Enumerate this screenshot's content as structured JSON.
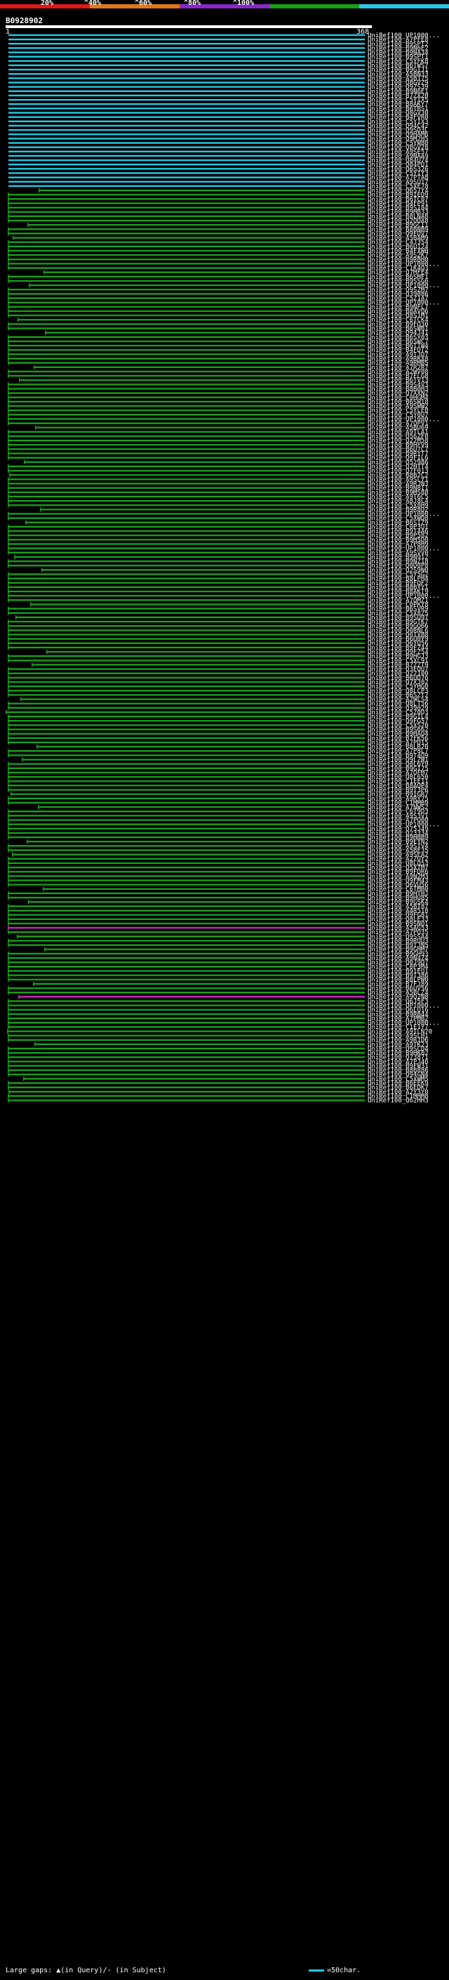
{
  "scale": {
    "ticks": [
      "20%",
      "^40%",
      "^60%",
      "^80%",
      "^100%"
    ],
    "colors": [
      "#e01818",
      "#e07818",
      "#8828c8",
      "#18a018",
      "#28c8e8"
    ]
  },
  "query": {
    "id": "B0928902",
    "start": "1",
    "end": "368"
  },
  "palette": {
    "cyan": "#28c8e8",
    "green": "#18a018",
    "magenta": "#c828b8",
    "gap": "#ffffff"
  },
  "hits": [
    {
      "label": "UniRef100_UP1000...",
      "color": "cyan"
    },
    {
      "label": "UniRef100_A7PFE8",
      "color": "cyan"
    },
    {
      "label": "UniRef100_B9SPT2",
      "color": "cyan"
    },
    {
      "label": "UniRef100_B9N6E2",
      "color": "cyan"
    },
    {
      "label": "UniRef100_B9NA34",
      "color": "cyan"
    },
    {
      "label": "UniRef100_B9SPT1",
      "color": "cyan"
    },
    {
      "label": "UniRef100_C5YFK8",
      "color": "cyan"
    },
    {
      "label": "UniRef100_B6TWS7",
      "color": "cyan"
    },
    {
      "label": "UniRef100_B9GIJ1",
      "color": "cyan"
    },
    {
      "label": "UniRef100_A5BN33",
      "color": "cyan"
    },
    {
      "label": "UniRef100_A5B175",
      "color": "cyan"
    },
    {
      "label": "UniRef100_Q8GVZ9",
      "color": "cyan"
    },
    {
      "label": "UniRef100_Q9ZS39",
      "color": "cyan"
    },
    {
      "label": "UniRef100_B9N6E1",
      "color": "cyan"
    },
    {
      "label": "UniRef100_B7ZX20",
      "color": "cyan"
    },
    {
      "label": "UniRef100_C5YIX5",
      "color": "cyan"
    },
    {
      "label": "UniRef100_B8AKY7",
      "color": "cyan"
    },
    {
      "label": "UniRef100_B6TBS1",
      "color": "cyan"
    },
    {
      "label": "UniRef100_Q8GV30",
      "color": "cyan"
    },
    {
      "label": "UniRef100_B4FVR0",
      "color": "cyan"
    },
    {
      "label": "UniRef100_C5YIX3",
      "color": "cyan"
    },
    {
      "label": "UniRef100_Q94C42",
      "color": "cyan"
    },
    {
      "label": "UniRef100_Q9SD3L",
      "color": "cyan"
    },
    {
      "label": "UniRef100_Q9HAM6",
      "color": "cyan"
    },
    {
      "label": "UniRef100_Q9M2H5",
      "color": "cyan"
    },
    {
      "label": "UniRef100_C5YW80",
      "color": "cyan"
    },
    {
      "label": "UniRef100_Q8GV28",
      "color": "cyan"
    },
    {
      "label": "UniRef100_A9SE57",
      "color": "cyan"
    },
    {
      "label": "UniRef100_A9NAA9",
      "color": "cyan"
    },
    {
      "label": "UniRef100_Q84U74",
      "color": "cyan"
    },
    {
      "label": "UniRef100_Q84PD1",
      "color": "cyan"
    },
    {
      "label": "UniRef100_Q6S326",
      "color": "cyan"
    },
    {
      "label": "UniRef100_C5YIY3",
      "color": "cyan"
    },
    {
      "label": "UniRef100_A7PTA8",
      "color": "cyan"
    },
    {
      "label": "UniRef100_A9SU17",
      "color": "cyan"
    },
    {
      "label": "UniRef100_C5XE78",
      "color": "cyan"
    },
    {
      "label": "UniRef100_Q657Y4",
      "color": "green"
    },
    {
      "label": "UniRef100_B9IED9",
      "color": "green"
    },
    {
      "label": "UniRef100_B6TC07",
      "color": "green"
    },
    {
      "label": "UniRef100_B4FP91",
      "color": "green"
    },
    {
      "label": "UniRef100_B9SI84",
      "color": "green"
    },
    {
      "label": "UniRef100_B9HB33",
      "color": "green"
    },
    {
      "label": "UniRef100_B8LNA8",
      "color": "green"
    },
    {
      "label": "UniRef100_Q2QDA8",
      "color": "green"
    },
    {
      "label": "UniRef100_B9GCI1",
      "color": "green"
    },
    {
      "label": "UniRef100_B8BNB9",
      "color": "green"
    },
    {
      "label": "UniRef100_Q9FDV7",
      "color": "green"
    },
    {
      "label": "UniRef100_A5BAM9",
      "color": "green"
    },
    {
      "label": "UniRef100_C4J354",
      "color": "green"
    },
    {
      "label": "UniRef100_B6U124",
      "color": "green"
    },
    {
      "label": "UniRef100_B4FXW0",
      "color": "green"
    },
    {
      "label": "UniRef100_A9S2K7",
      "color": "green"
    },
    {
      "label": "UniRef100_B9RBH0",
      "color": "green"
    },
    {
      "label": "UniRef100_UP1000...",
      "color": "green"
    },
    {
      "label": "UniRef100_C1K4Q3",
      "color": "green"
    },
    {
      "label": "UniRef100_Q7MFE4",
      "color": "green"
    },
    {
      "label": "UniRef100_B6SMF1",
      "color": "green"
    },
    {
      "label": "UniRef100_B9SSG6",
      "color": "green"
    },
    {
      "label": "UniRef100_UP1000...",
      "color": "green"
    },
    {
      "label": "UniRef100_Q9SZM7",
      "color": "green"
    },
    {
      "label": "UniRef100_Q39086",
      "color": "green"
    },
    {
      "label": "UniRef100_C5Z1A7",
      "color": "green"
    },
    {
      "label": "UniRef100_UP1000...",
      "color": "green"
    },
    {
      "label": "UniRef100_B9NFL7",
      "color": "green"
    },
    {
      "label": "UniRef100_B8AVQ6",
      "color": "green"
    },
    {
      "label": "UniRef100_Q8S1M1",
      "color": "green"
    },
    {
      "label": "UniRef100_C6TCK4",
      "color": "green"
    },
    {
      "label": "UniRef100_B9FQ30",
      "color": "green"
    },
    {
      "label": "UniRef100_B6SWB1",
      "color": "green"
    },
    {
      "label": "UniRef100_Q94J41",
      "color": "green"
    },
    {
      "label": "UniRef100_B6SY03",
      "color": "green"
    },
    {
      "label": "UniRef100_B6SWC7",
      "color": "green"
    },
    {
      "label": "UniRef100_B6TTW4",
      "color": "green"
    },
    {
      "label": "UniRef100_B4FDT2",
      "color": "green"
    },
    {
      "label": "UniRef100_A9TJD7",
      "color": "green"
    },
    {
      "label": "UniRef100_A9RKX8",
      "color": "green"
    },
    {
      "label": "UniRef100_A9RMB5",
      "color": "green"
    },
    {
      "label": "UniRef100_A7R2R7",
      "color": "green"
    },
    {
      "label": "UniRef100_A2WV08",
      "color": "green"
    },
    {
      "label": "UniRef100_B7FLG8",
      "color": "green"
    },
    {
      "label": "UniRef100_B6TV13",
      "color": "green"
    },
    {
      "label": "UniRef100_B9S4V3",
      "color": "green"
    },
    {
      "label": "UniRef100_B8B0H3",
      "color": "green"
    },
    {
      "label": "UniRef100_Q7XXN2",
      "color": "green"
    },
    {
      "label": "UniRef100_C0HGM4",
      "color": "green"
    },
    {
      "label": "UniRef100_B6SW18",
      "color": "green"
    },
    {
      "label": "UniRef100_A9SWW2",
      "color": "green"
    },
    {
      "label": "UniRef100_C5YLE0",
      "color": "green"
    },
    {
      "label": "UniRef100_C5Y0U7",
      "color": "green"
    },
    {
      "label": "UniRef100_UP1000...",
      "color": "green"
    },
    {
      "label": "UniRef100_A7QPV1",
      "color": "green"
    },
    {
      "label": "UniRef100_A5BU69",
      "color": "green"
    },
    {
      "label": "UniRef100_A9TLA1",
      "color": "green"
    },
    {
      "label": "UniRef100_Q56ZF0",
      "color": "green"
    },
    {
      "label": "UniRef100_Q22M58",
      "color": "green"
    },
    {
      "label": "UniRef100_B9HFV9",
      "color": "green"
    },
    {
      "label": "UniRef100_B6U7C7",
      "color": "green"
    },
    {
      "label": "UniRef100_B9RYT7",
      "color": "green"
    },
    {
      "label": "UniRef100_Q9FIL6",
      "color": "green"
    },
    {
      "label": "UniRef100_Q52986",
      "color": "green"
    },
    {
      "label": "UniRef100_Q2HTT4",
      "color": "green"
    },
    {
      "label": "UniRef100_Q7F013",
      "color": "green"
    },
    {
      "label": "UniRef100_B8B2C2",
      "color": "green"
    },
    {
      "label": "UniRef100_A9SLY1",
      "color": "green"
    },
    {
      "label": "UniRef100_A9RJN3",
      "color": "green"
    },
    {
      "label": "UniRef100_B9N8I1",
      "color": "green"
    },
    {
      "label": "UniRef100_B9MS88",
      "color": "green"
    },
    {
      "label": "UniRef100_A9T6C5",
      "color": "green"
    },
    {
      "label": "UniRef100_A8J8L4",
      "color": "green"
    },
    {
      "label": "UniRef100_C5X8H9",
      "color": "green"
    },
    {
      "label": "UniRef100_B9R8D2",
      "color": "green"
    },
    {
      "label": "UniRef100_UP1000...",
      "color": "green"
    },
    {
      "label": "UniRef100_C5XWD8",
      "color": "green"
    },
    {
      "label": "UniRef100_B6SIZ9",
      "color": "green"
    },
    {
      "label": "UniRef100_C0P3U1",
      "color": "green"
    },
    {
      "label": "UniRef100_B9T4A6",
      "color": "green"
    },
    {
      "label": "UniRef100_B9P582",
      "color": "green"
    },
    {
      "label": "UniRef100_B9M5D0",
      "color": "green"
    },
    {
      "label": "UniRef100_A7P8H9",
      "color": "green"
    },
    {
      "label": "UniRef100_UP1000...",
      "color": "green"
    },
    {
      "label": "UniRef100_A9SVV0",
      "color": "green"
    },
    {
      "label": "UniRef100_B9N912",
      "color": "green"
    },
    {
      "label": "UniRef100_B9NZ18",
      "color": "green"
    },
    {
      "label": "UniRef100_Q0D0P8",
      "color": "green"
    },
    {
      "label": "UniRef100_Q2S9N0",
      "color": "green"
    },
    {
      "label": "UniRef100_C5Y5G2",
      "color": "green"
    },
    {
      "label": "UniRef100_B8LPH4",
      "color": "green"
    },
    {
      "label": "UniRef100_B9FQF2",
      "color": "green"
    },
    {
      "label": "UniRef100_B8BYY1",
      "color": "green"
    },
    {
      "label": "UniRef100_B8AKT9",
      "color": "green"
    },
    {
      "label": "UniRef100_UP1000...",
      "color": "green"
    },
    {
      "label": "UniRef100_A7QMZ1",
      "color": "green"
    },
    {
      "label": "UniRef100_C0PKY8",
      "color": "green"
    },
    {
      "label": "UniRef100_B6SVR9",
      "color": "green"
    },
    {
      "label": "UniRef100_C5X8Z5",
      "color": "green"
    },
    {
      "label": "UniRef100_B9SU97",
      "color": "green"
    },
    {
      "label": "UniRef100_B9GTK7",
      "color": "green"
    },
    {
      "label": "UniRef100_B9GQ66",
      "color": "green"
    },
    {
      "label": "UniRef100_Q0RNL6",
      "color": "green"
    },
    {
      "label": "UniRef100_Q0IXB8",
      "color": "green"
    },
    {
      "label": "UniRef100_B6U0Y9",
      "color": "green"
    },
    {
      "label": "UniRef100_Q6YU56",
      "color": "green"
    },
    {
      "label": "UniRef100_B9FZ44",
      "color": "green"
    },
    {
      "label": "UniRef100_Q9FZ54",
      "color": "green"
    },
    {
      "label": "UniRef100_B9HGJ3",
      "color": "green"
    },
    {
      "label": "UniRef100_C5XL91",
      "color": "green"
    },
    {
      "label": "UniRef100_B7ZZT9",
      "color": "green"
    },
    {
      "label": "UniRef100_Q3EQU7",
      "color": "green"
    },
    {
      "label": "UniRef100_Q22100",
      "color": "green"
    },
    {
      "label": "UniRef100_B6UD76",
      "color": "green"
    },
    {
      "label": "UniRef100_Q7XJ02",
      "color": "green"
    },
    {
      "label": "UniRef100_C5YHG0",
      "color": "green"
    },
    {
      "label": "UniRef100_Q8LCP3",
      "color": "green"
    },
    {
      "label": "UniRef100_B6SZT2",
      "color": "green"
    },
    {
      "label": "UniRef100_A2WLS4",
      "color": "green"
    },
    {
      "label": "UniRef100_Q8LT56",
      "color": "green"
    },
    {
      "label": "UniRef100_Q39029",
      "color": "green"
    },
    {
      "label": "UniRef100_C5Z0D3",
      "color": "green"
    },
    {
      "label": "UniRef100_B9GIL4",
      "color": "green"
    },
    {
      "label": "UniRef100_Q9FG57",
      "color": "green"
    },
    {
      "label": "UniRef100_C5XS20",
      "color": "green"
    },
    {
      "label": "UniRef100_B9S662",
      "color": "green"
    },
    {
      "label": "UniRef100_B9HAU4",
      "color": "green"
    },
    {
      "label": "UniRef100_B7FK56",
      "color": "green"
    },
    {
      "label": "UniRef100_A7PD15",
      "color": "green"
    },
    {
      "label": "UniRef100_B8LR20",
      "color": "green"
    },
    {
      "label": "UniRef100_A7P8L7",
      "color": "green"
    },
    {
      "label": "UniRef100_B9T4Q9",
      "color": "green"
    },
    {
      "label": "UniRef100_Q9LZW1",
      "color": "green"
    },
    {
      "label": "UniRef100_Q8L6Y9",
      "color": "green"
    },
    {
      "label": "UniRef100_B9GI75",
      "color": "green"
    },
    {
      "label": "UniRef100_A7QFM7",
      "color": "green"
    },
    {
      "label": "UniRef100_Q8L650",
      "color": "green"
    },
    {
      "label": "UniRef100_C1EE11",
      "color": "green"
    },
    {
      "label": "UniRef100_B8AQP4",
      "color": "green"
    },
    {
      "label": "UniRef100_B9T3P6",
      "color": "green"
    },
    {
      "label": "UniRef100_B9IGR7",
      "color": "green"
    },
    {
      "label": "UniRef100_A9RY75",
      "color": "green"
    },
    {
      "label": "UniRef100_C1MMB9",
      "color": "green"
    },
    {
      "label": "UniRef100_A7NWS2",
      "color": "green"
    },
    {
      "label": "UniRef100_C6T9D3",
      "color": "green"
    },
    {
      "label": "UniRef100_A9S3V1",
      "color": "green"
    },
    {
      "label": "UniRef100_A7PU00",
      "color": "green"
    },
    {
      "label": "UniRef100_UP1000...",
      "color": "green"
    },
    {
      "label": "UniRef100_Q75J49",
      "color": "green"
    },
    {
      "label": "UniRef100_Q23334",
      "color": "green"
    },
    {
      "label": "UniRef100_B9HBB9",
      "color": "green"
    },
    {
      "label": "UniRef100_B9EYN2",
      "color": "green"
    },
    {
      "label": "UniRef100_A9SIV4",
      "color": "green"
    },
    {
      "label": "UniRef100_A5BE35",
      "color": "green"
    },
    {
      "label": "UniRef100_A9SEA2",
      "color": "green"
    },
    {
      "label": "UniRef100_A2ZUY2",
      "color": "green"
    },
    {
      "label": "UniRef100_Q8LQ53",
      "color": "green"
    },
    {
      "label": "UniRef100_Q5XTM7",
      "color": "green"
    },
    {
      "label": "UniRef100_B9FDR6",
      "color": "green"
    },
    {
      "label": "UniRef100_A9N2M3",
      "color": "green"
    },
    {
      "label": "UniRef100_Q9FM43",
      "color": "green"
    },
    {
      "label": "UniRef100_Q6VU56",
      "color": "green"
    },
    {
      "label": "UniRef100_C6TMB0",
      "color": "green"
    },
    {
      "label": "UniRef100_B9HTHJ",
      "color": "green"
    },
    {
      "label": "UniRef100_B9HU85",
      "color": "green"
    },
    {
      "label": "UniRef100_B9GSK4",
      "color": "green"
    },
    {
      "label": "UniRef100_A5BI87",
      "color": "green"
    },
    {
      "label": "UniRef100_A4R518",
      "color": "green"
    },
    {
      "label": "UniRef100_Q9FG81",
      "color": "green"
    },
    {
      "label": "UniRef100_Q8LE33",
      "color": "green"
    },
    {
      "label": "UniRef100_B9SNQ1",
      "color": "green"
    },
    {
      "label": "UniRef100_A5AG53",
      "color": "magenta"
    },
    {
      "label": "UniRef100_A7PQ35",
      "color": "green"
    },
    {
      "label": "UniRef100_Q9SSA4",
      "color": "green"
    },
    {
      "label": "UniRef100_B9RUU3",
      "color": "green"
    },
    {
      "label": "UniRef100_B9IJN5",
      "color": "green"
    },
    {
      "label": "UniRef100_B9GHM7",
      "color": "green"
    },
    {
      "label": "UniRef100_B9GH93",
      "color": "green"
    },
    {
      "label": "UniRef100_A9N4Z4",
      "color": "green"
    },
    {
      "label": "UniRef100_Q0J9D7",
      "color": "green"
    },
    {
      "label": "UniRef100_C0P3M4",
      "color": "green"
    },
    {
      "label": "UniRef100_B9IEQ1",
      "color": "green"
    },
    {
      "label": "UniRef100_B9I386",
      "color": "green"
    },
    {
      "label": "UniRef100_B8LPW0",
      "color": "green"
    },
    {
      "label": "UniRef100_B7FJ89",
      "color": "green"
    },
    {
      "label": "UniRef100_B6UV56",
      "color": "green"
    },
    {
      "label": "UniRef100_A5BLZ4",
      "color": "green"
    },
    {
      "label": "UniRef100_A9Q2N8",
      "color": "magenta"
    },
    {
      "label": "UniRef100_Q6J5F3",
      "color": "green"
    },
    {
      "label": "UniRef100_UP1000...",
      "color": "green"
    },
    {
      "label": "UniRef100_Q6LU16",
      "color": "green"
    },
    {
      "label": "UniRef100_B9RB44",
      "color": "green"
    },
    {
      "label": "UniRef100_A7PMB2",
      "color": "green"
    },
    {
      "label": "UniRef100_UP1000...",
      "color": "green"
    },
    {
      "label": "UniRef100_C1E1Y7",
      "color": "green"
    },
    {
      "label": "UniRef100_A9ILN70",
      "color": "green"
    },
    {
      "label": "UniRef100_A9SLH1",
      "color": "green"
    },
    {
      "label": "UniRef100_A9R1D6",
      "color": "green"
    },
    {
      "label": "UniRef100_A9TK23",
      "color": "green"
    },
    {
      "label": "UniRef100_Q9SCD4",
      "color": "green"
    },
    {
      "label": "UniRef100_B9HK02",
      "color": "green"
    },
    {
      "label": "UniRef100_Q73871",
      "color": "green"
    },
    {
      "label": "UniRef100_A7PJ46",
      "color": "green"
    },
    {
      "label": "UniRef100_B9FW31",
      "color": "green"
    },
    {
      "label": "UniRef100_B8B886",
      "color": "green"
    },
    {
      "label": "UniRef100_Q94GN4",
      "color": "green"
    },
    {
      "label": "UniRef100_C5XWM5",
      "color": "green"
    },
    {
      "label": "UniRef100_B6EEK9",
      "color": "green"
    },
    {
      "label": "UniRef100_B6EDK7",
      "color": "green"
    },
    {
      "label": "UniRef100_A2Y3Y0",
      "color": "green"
    },
    {
      "label": "UniRef100_C1MHM8",
      "color": "green"
    },
    {
      "label": "UniRef100_Q62HH3",
      "color": "green"
    }
  ],
  "legend": {
    "left": "Large gaps: ▲(in Query)/- (in Subject)",
    "right": "=50char."
  }
}
